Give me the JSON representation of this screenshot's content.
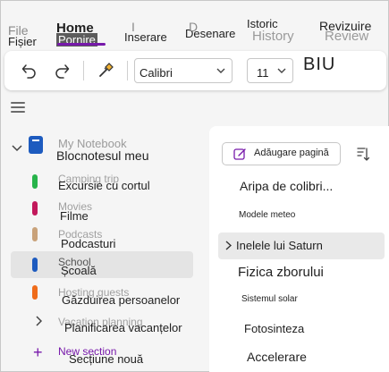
{
  "tabs": {
    "file": {
      "ghost": "File",
      "label": "Fișier"
    },
    "home": {
      "ghost": "Home",
      "label": "Pornire"
    },
    "insert": {
      "ghost": "I",
      "label": "Inserare"
    },
    "draw": {
      "ghost": "D",
      "label": "Desenare"
    },
    "history": {
      "ghost": "History",
      "label": "Istoric"
    },
    "review": {
      "ghost": "Review",
      "label": "Revizuire"
    }
  },
  "ribbon": {
    "font_name": "Calibri",
    "font_size": "11",
    "biu": "BIU"
  },
  "notebook": {
    "ghost": "My Notebook",
    "title": "Blocnotesul meu"
  },
  "sections": [
    {
      "ghost": "Camping trip",
      "label": "Excursie cu cortul",
      "color": "#27b34a"
    },
    {
      "ghost": "Movies",
      "label": "Filme",
      "color": "#c2185b"
    },
    {
      "ghost": "Podcasts",
      "label": "Podcasturi",
      "color": "#c9a27a"
    },
    {
      "ghost": "School",
      "label": "Școală",
      "color": "#1d5bbf"
    },
    {
      "ghost": "Hosting guests",
      "label": "Găzduirea persoanelor",
      "color": "#ef6c1a"
    },
    {
      "ghost": "Vacation planning",
      "label": "Planificarea vacanțelor",
      "color": ""
    }
  ],
  "new_section": {
    "ghost": "New section",
    "label": "Secțiune nouă"
  },
  "pages_pane": {
    "add_page_label": "Adăugare pagină",
    "pages": [
      {
        "label": "Aripa de colibri...",
        "size": "14px"
      },
      {
        "label": "Modele meteo",
        "size": "10px"
      },
      {
        "label": "Inelele lui Saturn",
        "size": "13px"
      },
      {
        "label": "Fizica zborului",
        "size": "15px"
      },
      {
        "label": "Sistemul solar",
        "size": "10px"
      },
      {
        "label": "Fotosinteza",
        "size": "13px"
      },
      {
        "label": "Accelerare",
        "size": "14px"
      }
    ]
  },
  "colors": {
    "accent": "#7719aa",
    "notebook": "#1d5bbf"
  }
}
